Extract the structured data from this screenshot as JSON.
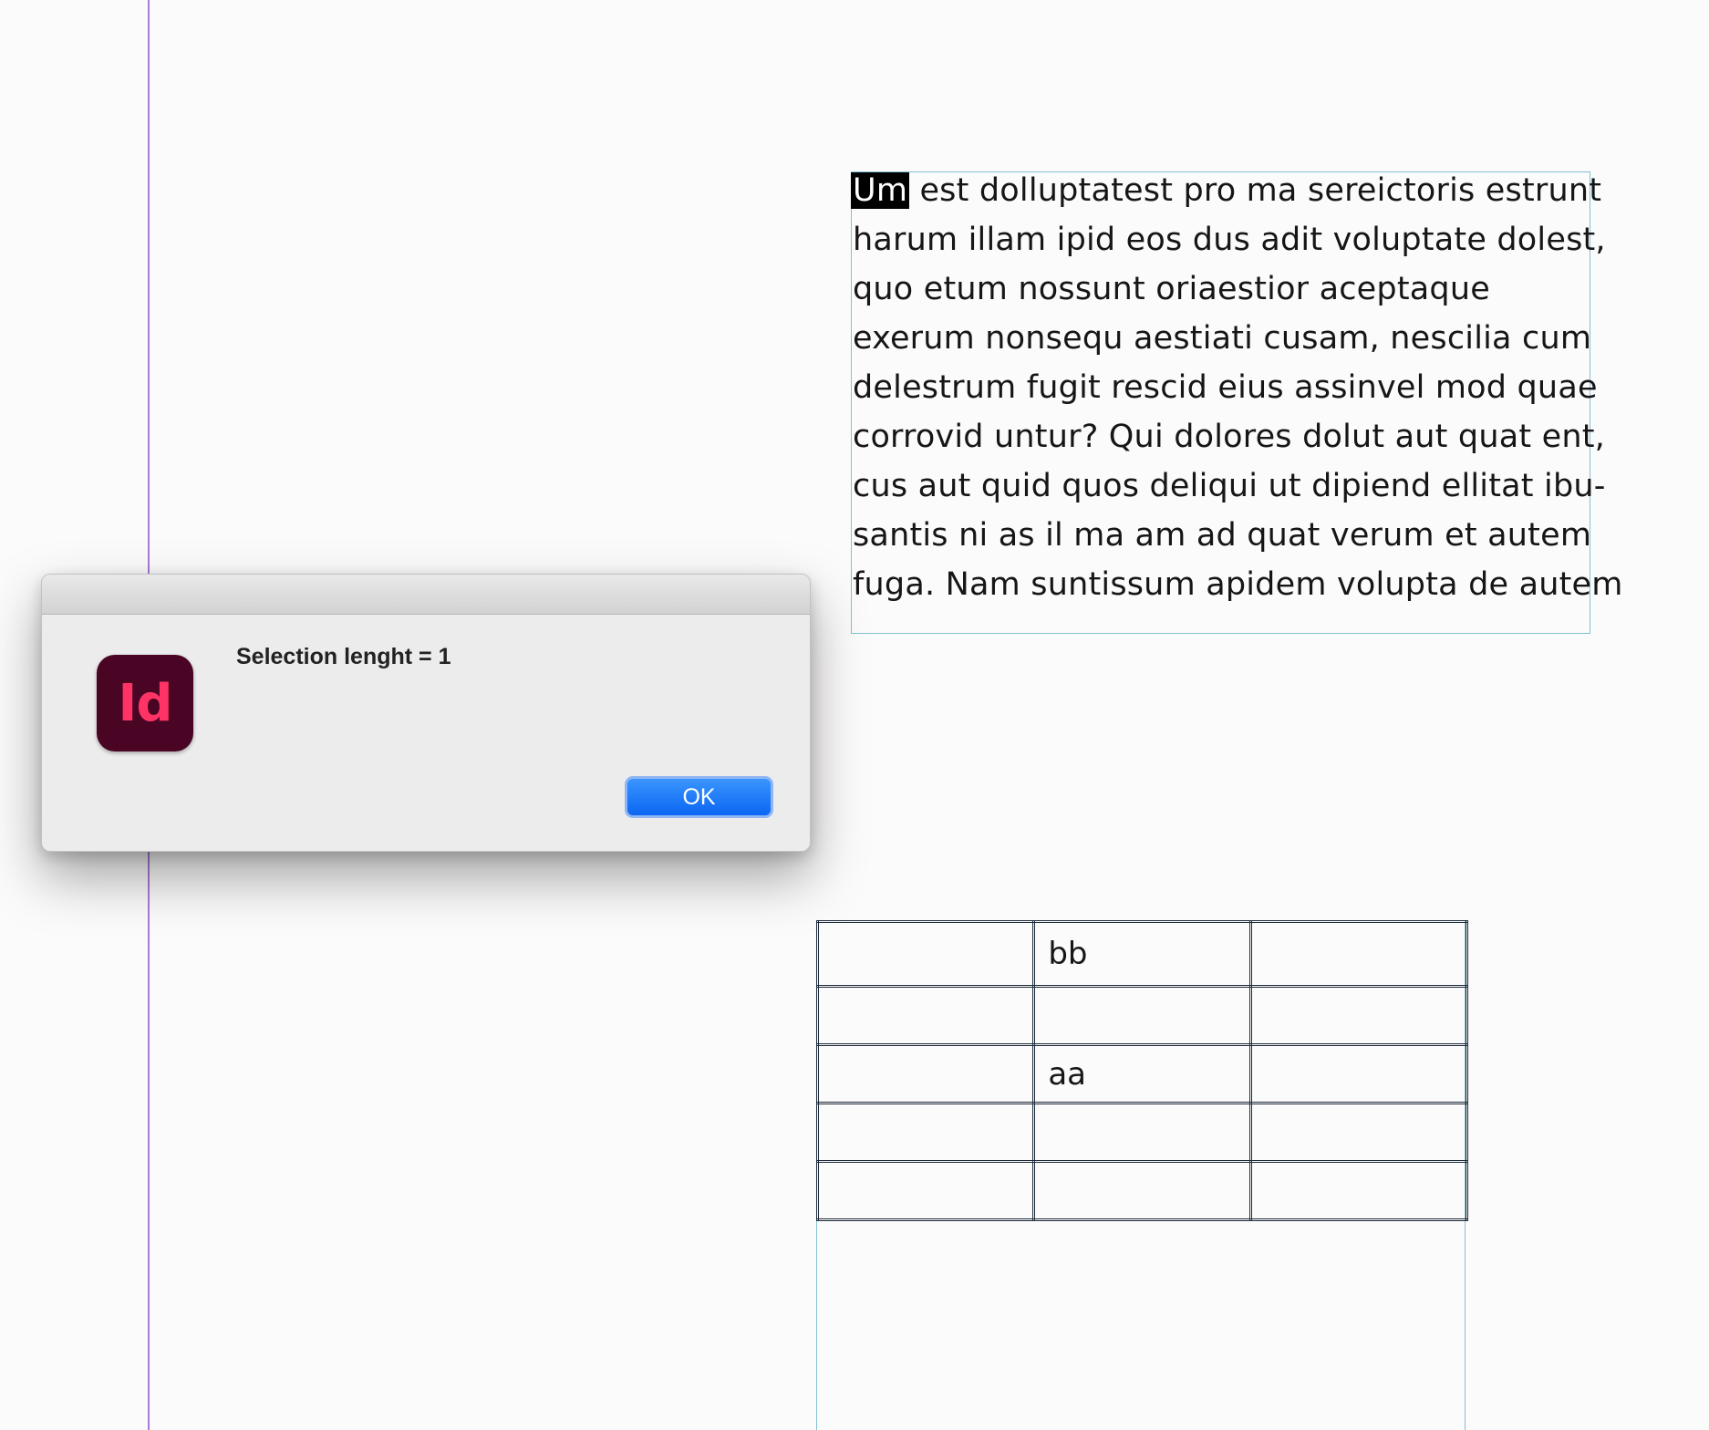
{
  "document": {
    "text_frame": {
      "selected_text": "Um",
      "first_line_rest": " est dolluptatest pro ma sereictoris estrunt",
      "lines": [
        "harum illam ipid eos dus adit voluptate dolest,",
        "quo etum nossunt oriaestior aceptaque",
        "exerum nonsequ aestiati cusam, nescilia cum",
        "delestrum fugit rescid eius assinvel mod quae",
        "corrovid untur? Qui dolores dolut aut quat ent,",
        "cus aut quid quos deliqui ut dipiend ellitat ibu-",
        "santis ni as il ma am ad quat verum et autem",
        "fuga. Nam suntissum apidem volupta de autem"
      ]
    },
    "table": {
      "rows": [
        [
          "",
          "bb",
          ""
        ],
        [
          "",
          "",
          ""
        ],
        [
          "",
          "aa",
          ""
        ],
        [
          "",
          "",
          ""
        ],
        [
          "",
          "",
          ""
        ]
      ]
    }
  },
  "dialog": {
    "app_icon_text": "Id",
    "message": "Selection lenght = 1",
    "ok_label": "OK"
  },
  "colors": {
    "margin_guide": "#a77bd6",
    "frame_edge": "#7fc2d3",
    "icon_background": "#4b0524",
    "icon_letters": "#ff3366",
    "button_blue": "#0b66f2"
  },
  "icons": {
    "app": "indesign-app-icon"
  }
}
